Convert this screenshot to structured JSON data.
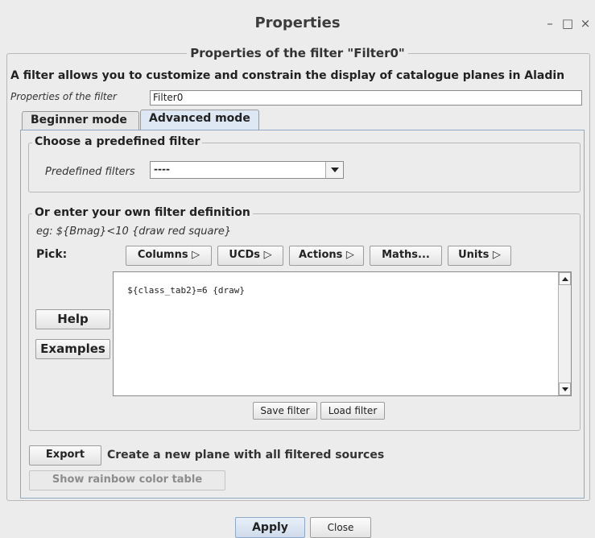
{
  "window": {
    "title": "Properties",
    "minimize_glyph": "–",
    "maximize_glyph": "□",
    "close_glyph": "×"
  },
  "filter": {
    "group_title": "Properties of the filter \"Filter0\"",
    "description": "A filter allows you to customize and constrain the display of catalogue planes in Aladin",
    "name_label": "Properties of the filter",
    "name_value": "Filter0"
  },
  "tabs": [
    {
      "label": "Beginner mode",
      "active": false
    },
    {
      "label": "Advanced mode",
      "active": true
    }
  ],
  "predefined": {
    "group_title": "Choose a predefined filter",
    "label": "Predefined filters",
    "selected": "----"
  },
  "custom": {
    "group_title": "Or enter your own filter definition",
    "example": "eg: ${Bmag}<10 {draw red square}",
    "pick_label": "Pick:",
    "pick_buttons": [
      "Columns ▷",
      "UCDs ▷",
      "Actions ▷",
      "Maths...",
      "Units ▷"
    ],
    "definition": "${class_tab2}=6 {draw}",
    "help_label": "Help",
    "examples_label": "Examples",
    "save_label": "Save filter",
    "load_label": "Load filter"
  },
  "export": {
    "button_label": "Export",
    "description": "Create a new plane with all filtered sources",
    "rainbow_label": "Show rainbow color table"
  },
  "footer": {
    "apply_label": "Apply",
    "close_label": "Close"
  }
}
